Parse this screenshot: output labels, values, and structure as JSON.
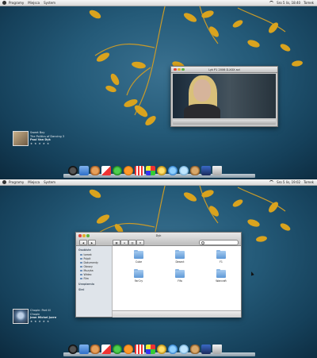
{
  "menubar": {
    "menus": [
      "Programy",
      "Miejsca",
      "System"
    ],
    "clock": "Sro 5 lis, 18:40",
    "user": "Tomek"
  },
  "menubar2": {
    "menus": [
      "Programy",
      "Miejsca",
      "System"
    ],
    "clock": "Sro 5 lis, 19:02",
    "user": "Tomek"
  },
  "nowplaying1": {
    "line1": "Sweet Boy",
    "line2": "The Politics of Dancing 3",
    "line3": "Paul Van Dyk",
    "stars": "★ ★ ★ ★ ★"
  },
  "nowplaying2": {
    "line1": "Chopin: Part III",
    "line2": "Chopin",
    "line3": "Jean Michel Jarre",
    "stars": "★ ★ ★ ★ ★"
  },
  "quicktime": {
    "title": "Lyk P1 2006 D-XXX avi"
  },
  "finder": {
    "title": "Dyk",
    "sidebar_section1": "Osobiste",
    "sidebar_items": [
      "tomek",
      "Pulpit",
      "Dokumenty",
      "Obrazy",
      "Muzyka",
      "Wideo",
      "Film"
    ],
    "sidebar_section2": "Urządzenia",
    "sidebar_section3": "Sieć",
    "folders": [
      "Cube",
      "Desect",
      "F1",
      "FarCry",
      "Fifa",
      "Warcraft"
    ]
  },
  "dock": {
    "icon_names": [
      "bomb-icon",
      "finder-icon",
      "cat-icon",
      "cards-icon",
      "clover-icon",
      "pumpkin-icon",
      "popcorn-icon",
      "puzzle-icon",
      "star-icon",
      "globe-icon",
      "face-icon",
      "deer-icon",
      "clapper-icon",
      "trash-icon"
    ]
  },
  "colors": {
    "wallpaper": "#245a78",
    "leaf": "#d9a31e",
    "close": "#e0453c",
    "minimize": "#e5b12c",
    "zoom": "#5fb43f"
  }
}
